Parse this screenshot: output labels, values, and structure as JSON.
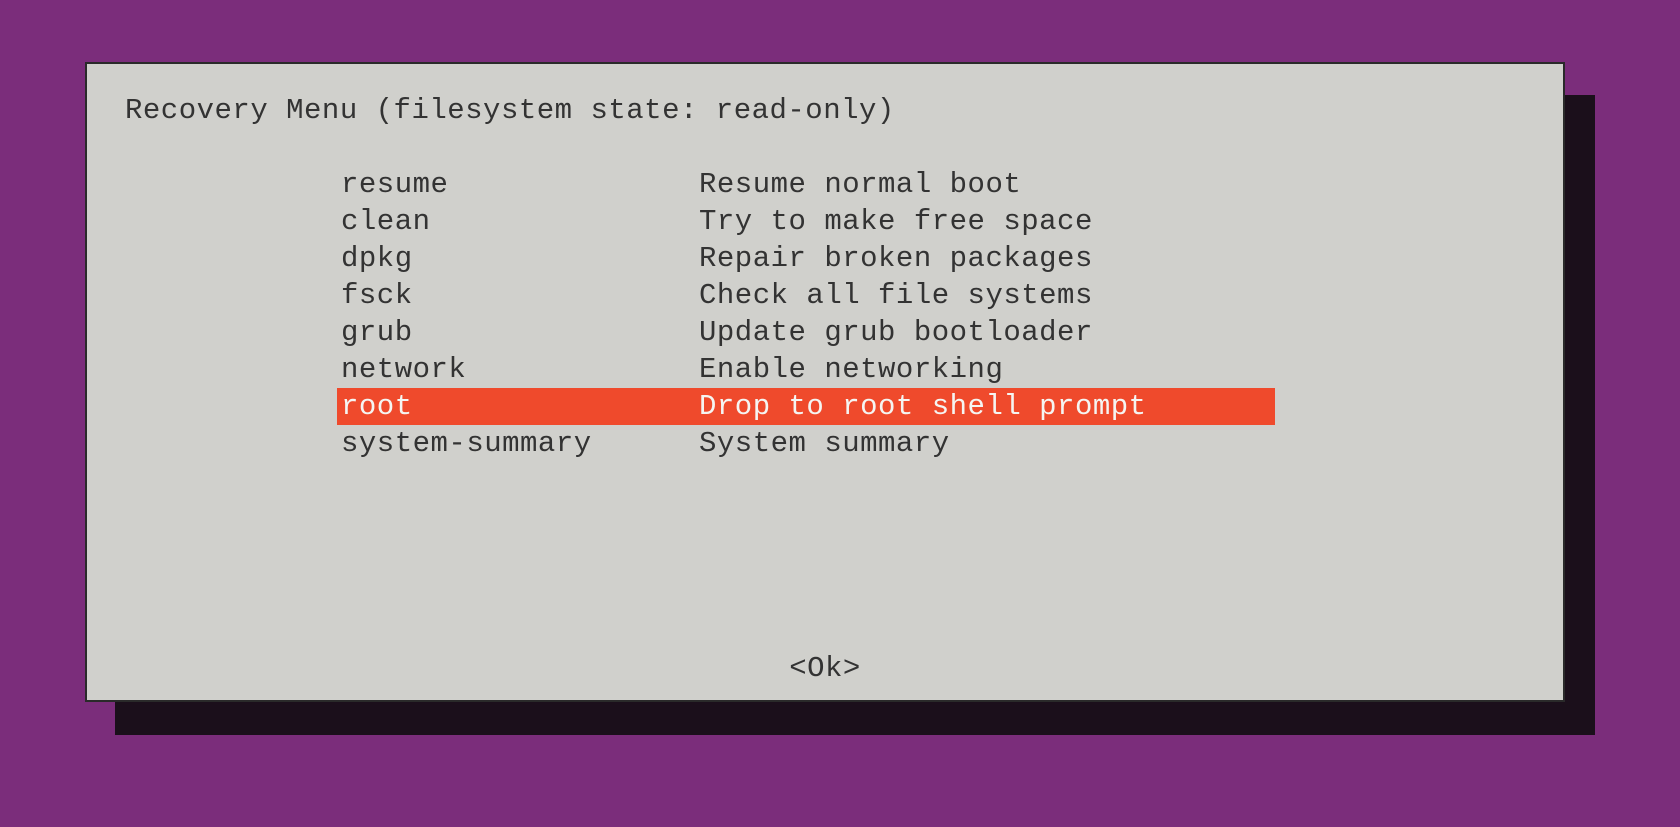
{
  "title": "Recovery Menu (filesystem state: read-only)",
  "selected_index": 6,
  "menu": [
    {
      "key": "resume",
      "desc": "Resume normal boot"
    },
    {
      "key": "clean",
      "desc": "Try to make free space"
    },
    {
      "key": "dpkg",
      "desc": "Repair broken packages"
    },
    {
      "key": "fsck",
      "desc": "Check all file systems"
    },
    {
      "key": "grub",
      "desc": "Update grub bootloader"
    },
    {
      "key": "network",
      "desc": "Enable networking"
    },
    {
      "key": "root",
      "desc": "Drop to root shell prompt"
    },
    {
      "key": "system-summary",
      "desc": "System summary"
    }
  ],
  "ok_label": "<Ok>"
}
